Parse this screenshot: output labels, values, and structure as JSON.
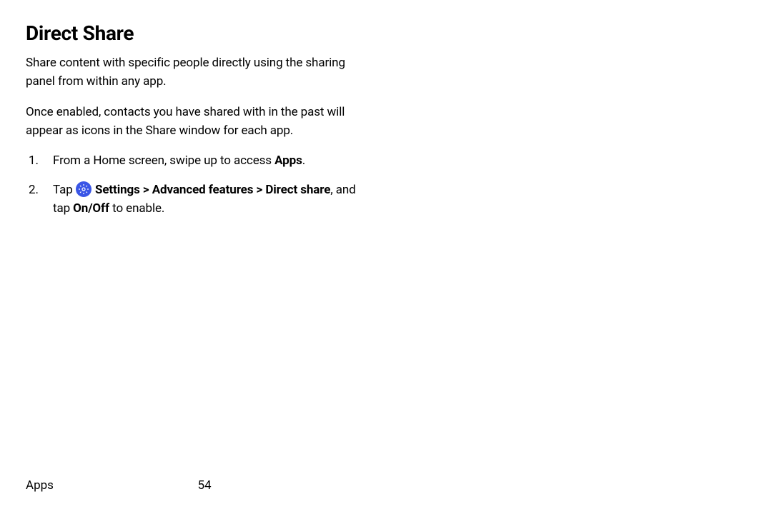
{
  "title": "Direct Share",
  "para1": "Share content with specific people directly using the sharing panel from within any app.",
  "para2": "Once enabled, contacts you have shared with in the past will appear as icons in the Share window for each app.",
  "step1": {
    "prefix": "From a Home screen, swipe up to access ",
    "bold": "Apps",
    "suffix": "."
  },
  "step2": {
    "tap": "Tap ",
    "settings": "Settings",
    "arrow1": " > ",
    "advanced": "Advanced features",
    "arrow2": " > ",
    "directshare": "Direct share",
    "mid": ", and tap ",
    "onoff": "On/Off",
    "end": " to enable."
  },
  "footer": {
    "section": "Apps",
    "page": "54"
  },
  "colors": {
    "icon_bg": "#3a56e6"
  }
}
